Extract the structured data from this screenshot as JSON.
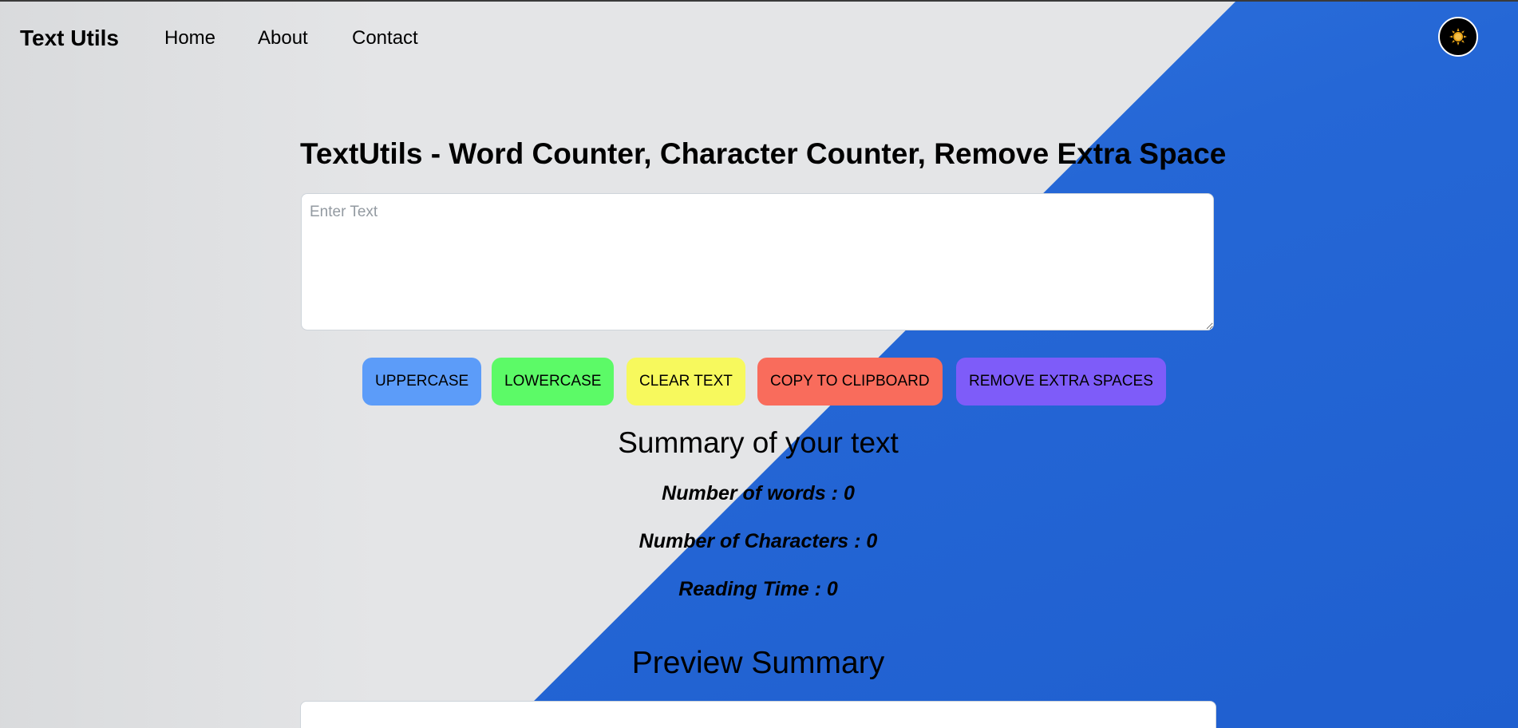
{
  "navbar": {
    "brand": "Text Utils",
    "links": [
      "Home",
      "About",
      "Contact"
    ],
    "mode_toggle_icon": "sun-icon"
  },
  "main": {
    "title": "TextUtils - Word Counter, Character Counter, Remove Extra Space",
    "textarea": {
      "placeholder": "Enter Text",
      "value": ""
    },
    "buttons": {
      "uppercase": "UPPERCASE",
      "lowercase": "LOWERCASE",
      "clear": "CLEAR TEXT",
      "copy": "COPY TO CLIPBOARD",
      "remove_spaces": "REMOVE EXTRA SPACES"
    },
    "button_colors": {
      "uppercase": "#5c9cf9",
      "lowercase": "#5cfa67",
      "clear": "#f7f95d",
      "copy": "#f96c5c",
      "remove_spaces": "#7e5cf9"
    },
    "summary": {
      "heading": "Summary of your text",
      "words": "Number of words : 0",
      "characters": "Number of Characters : 0",
      "reading_time": "Reading Time : 0"
    },
    "preview": {
      "heading": "Preview Summary",
      "content": ""
    }
  }
}
